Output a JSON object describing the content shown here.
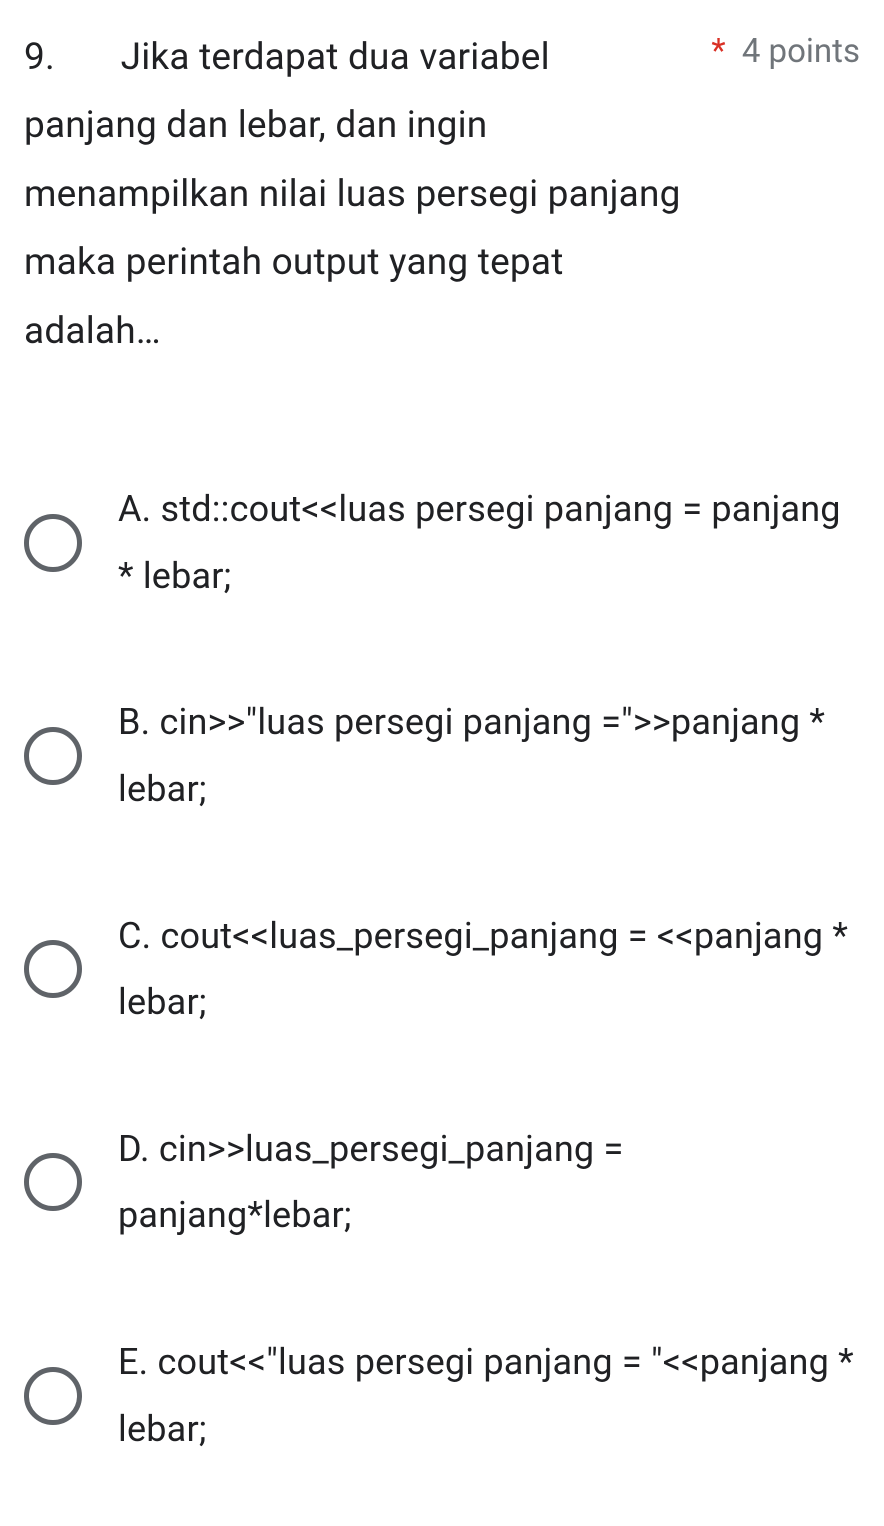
{
  "question": {
    "number": "9.",
    "text": "Jika terdapat dua variabel panjang dan lebar, dan ingin menampilkan nilai luas persegi panjang maka perintah output yang tepat adalah…",
    "required_mark": "*",
    "points_label": "4 points"
  },
  "options": [
    {
      "label": "A. std::cout<<luas persegi panjang = panjang * lebar;"
    },
    {
      "label": "B. cin>>\"luas persegi panjang =\">>panjang * lebar;"
    },
    {
      "label": "C. cout<<luas_persegi_panjang = <<panjang * lebar;"
    },
    {
      "label": "D. cin>>luas_persegi_panjang = panjang*lebar;"
    },
    {
      "label": "E. cout<<\"luas persegi panjang = \"<<panjang * lebar;"
    }
  ]
}
